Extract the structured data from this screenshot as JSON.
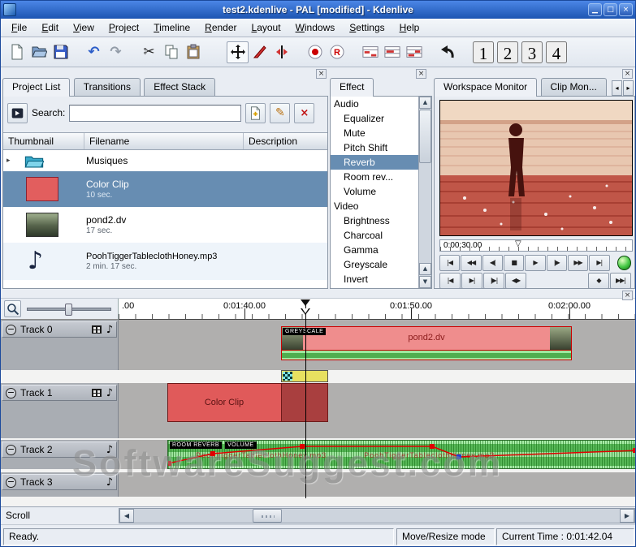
{
  "window": {
    "title": "test2.kdenlive - PAL [modified] - Kdenlive"
  },
  "menu": {
    "items": [
      "File",
      "Edit",
      "View",
      "Project",
      "Timeline",
      "Render",
      "Layout",
      "Windows",
      "Settings",
      "Help"
    ]
  },
  "toolbar": {
    "numbers": [
      "1",
      "2",
      "3",
      "4"
    ]
  },
  "project_panel": {
    "tabs": [
      {
        "label": "Project List"
      },
      {
        "label": "Transitions"
      },
      {
        "label": "Effect Stack"
      }
    ],
    "search_label": "Search:",
    "search_value": "",
    "columns": [
      "Thumbnail",
      "Filename",
      "Description"
    ],
    "rows": [
      {
        "name": "Musiques",
        "duration": "",
        "type": "folder",
        "selected": false
      },
      {
        "name": "Color Clip",
        "duration": "10 sec.",
        "type": "color",
        "selected": true
      },
      {
        "name": "pond2.dv",
        "duration": "17 sec.",
        "type": "video",
        "selected": false
      },
      {
        "name": "PoohTiggerTableclothHoney.mp3",
        "duration": "2 min. 17 sec.",
        "type": "audio",
        "selected": false
      }
    ]
  },
  "effect_panel": {
    "title": "Effect",
    "groups": [
      {
        "label": "Audio",
        "items": [
          {
            "label": "Equalizer"
          },
          {
            "label": "Mute"
          },
          {
            "label": "Pitch Shift"
          },
          {
            "label": "Reverb",
            "selected": true
          },
          {
            "label": "Room rev..."
          },
          {
            "label": "Volume"
          }
        ]
      },
      {
        "label": "Video",
        "items": [
          {
            "label": "Brightness"
          },
          {
            "label": "Charcoal"
          },
          {
            "label": "Gamma"
          },
          {
            "label": "Greyscale"
          },
          {
            "label": "Invert"
          }
        ]
      }
    ]
  },
  "monitor": {
    "tabs": [
      {
        "label": "Workspace Monitor"
      },
      {
        "label": "Clip Mon..."
      }
    ],
    "timecode": "0:00:30.00",
    "transport_row1": [
      {
        "name": "go-start",
        "glyph": "|◀"
      },
      {
        "name": "rewind",
        "glyph": "◀◀"
      },
      {
        "name": "frame-back",
        "glyph": "◀|"
      },
      {
        "name": "stop",
        "glyph": "■"
      },
      {
        "name": "play",
        "glyph": "▶"
      },
      {
        "name": "frame-forward",
        "glyph": "|▶"
      },
      {
        "name": "fast-forward",
        "glyph": "▶▶"
      },
      {
        "name": "go-end",
        "glyph": "▶|"
      }
    ],
    "transport_row2_left": [
      {
        "name": "set-inpoint",
        "glyph": "|◀"
      },
      {
        "name": "set-outpoint",
        "glyph": "▶|"
      },
      {
        "name": "play-section",
        "glyph": "|▶|"
      },
      {
        "name": "play-between",
        "glyph": "◀▶"
      }
    ],
    "transport_row2_right": [
      {
        "name": "marker",
        "glyph": "◆"
      },
      {
        "name": "play-loop",
        "glyph": "▶▶|"
      }
    ]
  },
  "timeline": {
    "ruler_labels": [
      ".00",
      "0:01:40.00",
      "0:01:50.00",
      "0:02:00.00"
    ],
    "tracks": [
      {
        "name": "Track 0",
        "video": true,
        "audio": true
      },
      {
        "name": "Track 1",
        "video": true,
        "audio": true
      },
      {
        "name": "Track 2",
        "video": false,
        "audio": true
      },
      {
        "name": "Track 3",
        "video": false,
        "audio": true
      }
    ],
    "clips": {
      "pond2": {
        "label": "pond2.dv",
        "tag": "GREYSCALE"
      },
      "color": {
        "label": "Color Clip"
      },
      "audio": {
        "tags": [
          "ROOM REVERB",
          "VOLUME"
        ],
        "label": "PoohTiggerTableclothHoney.mp3"
      }
    },
    "scroll_label": "Scroll"
  },
  "statusbar": {
    "ready": "Ready.",
    "mode": "Move/Resize mode",
    "time": "Current Time : 0:01:42.04"
  },
  "watermark": "SoftwareSuggest.com",
  "colors": {
    "titlebar": "#2b66c4",
    "selection": "#678db2",
    "clip_red": "#e25e5e",
    "audio_green": "#7fd87f",
    "record_red": "#cc0000"
  }
}
